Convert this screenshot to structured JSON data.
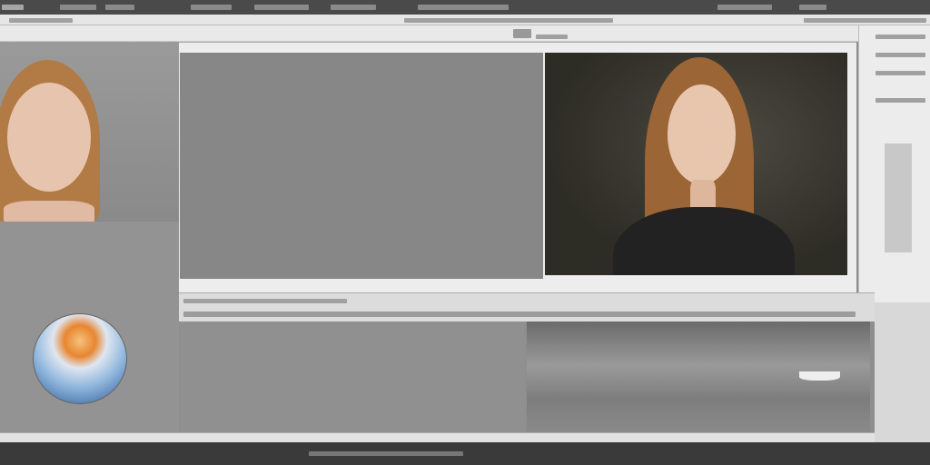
{
  "window": {
    "title": ""
  },
  "colors": {
    "titlebar": "#4a4a4a",
    "menubar": "#e6e6e6",
    "canvas_bg": "#ededed",
    "workspace": "#8e8e8e",
    "taskbar": "#3a3a3a"
  },
  "documents": [
    {
      "kind": "portrait-thumbnail"
    },
    {
      "kind": "orb-thumbnail"
    },
    {
      "kind": "blank-grey-canvas"
    },
    {
      "kind": "portrait-photo"
    },
    {
      "kind": "blank-grey-canvas"
    },
    {
      "kind": "seascape-with-boat"
    }
  ],
  "icons": [
    "app-icon",
    "zoom-icon",
    "taskbar-app-icon"
  ]
}
